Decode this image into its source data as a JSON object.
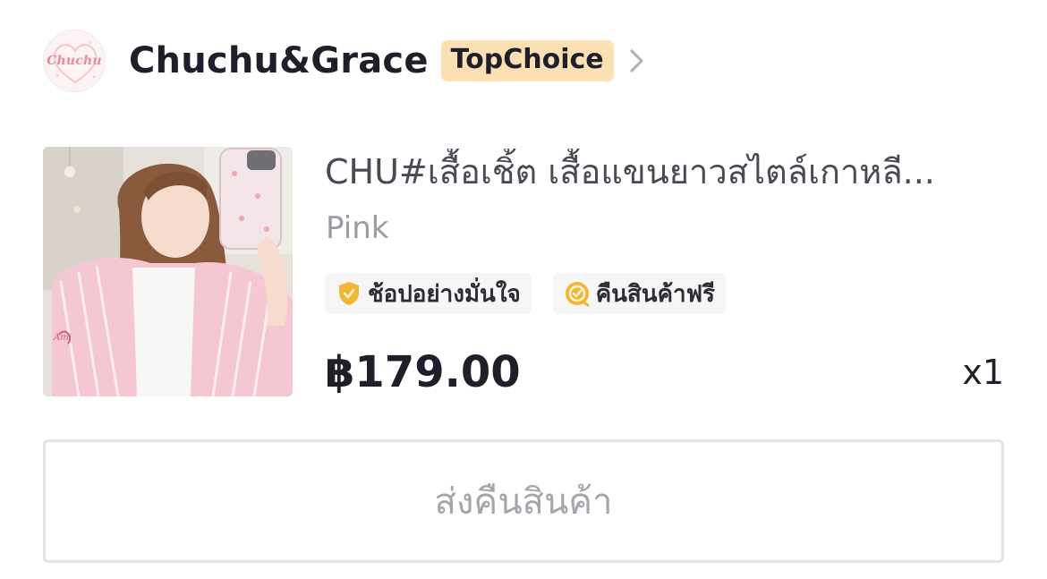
{
  "shop": {
    "logo_text": "Chuchu",
    "name": "Chuchu&Grace",
    "badge": "TopChoice",
    "icons": {
      "chevron": "chevron-right-icon"
    }
  },
  "product": {
    "image_icon": "product-photo",
    "title": "CHU#เสื้อเชิ้ต เสื้อแขนยาวสไตล์เกาหลี...",
    "variant": "Pink",
    "tags": [
      {
        "label": "ช้อปอย่างมั่นใจ",
        "icon": "shield-check-icon",
        "color": "#f2b632"
      },
      {
        "label": "คืนสินค้าฟรี",
        "icon": "return-badge-icon",
        "color": "#f2b632"
      }
    ],
    "price": "฿179.00",
    "quantity": "x1"
  },
  "actions": {
    "return_label": "ส่งคืนสินค้า"
  },
  "colors": {
    "badge_bg": "#fbe0b3",
    "text_primary": "#1f1f2b",
    "text_muted": "#9a9aa1",
    "accent_gold": "#f2b632",
    "logo_pink": "#e8899c"
  }
}
